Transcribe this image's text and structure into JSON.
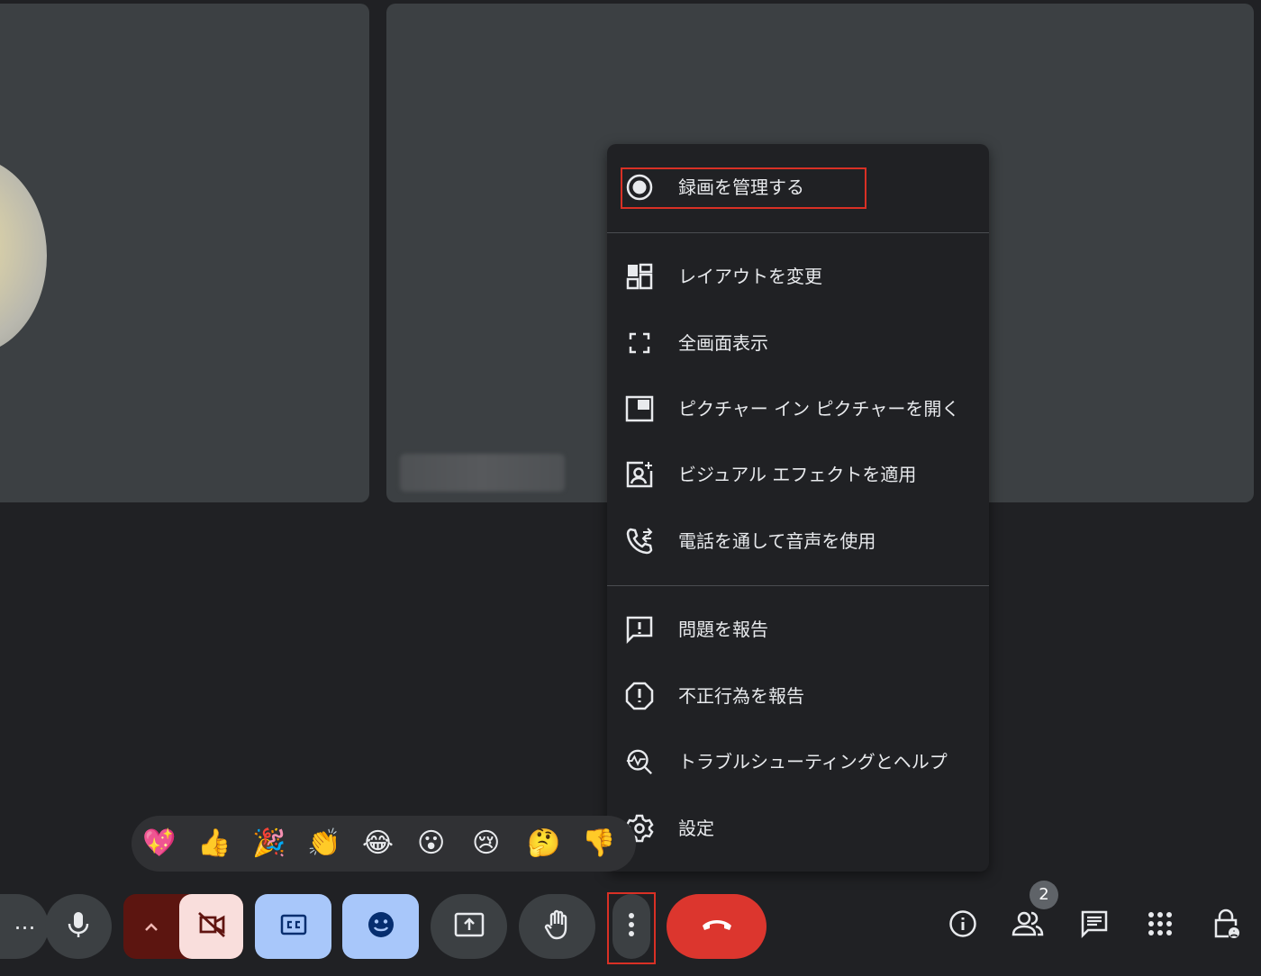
{
  "menu": {
    "items": [
      {
        "label": "録画を管理する",
        "icon": "record-icon"
      },
      {
        "label": "レイアウトを変更",
        "icon": "layout-icon"
      },
      {
        "label": "全画面表示",
        "icon": "fullscreen-icon"
      },
      {
        "label": "ピクチャー イン ピクチャーを開く",
        "icon": "picture-in-picture-icon"
      },
      {
        "label": "ビジュアル エフェクトを適用",
        "icon": "visual-effects-icon"
      },
      {
        "label": "電話を通して音声を使用",
        "icon": "phone-forward-icon"
      },
      {
        "label": "問題を報告",
        "icon": "feedback-icon"
      },
      {
        "label": "不正行為を報告",
        "icon": "report-abuse-icon"
      },
      {
        "label": "トラブルシューティングとヘルプ",
        "icon": "troubleshoot-icon"
      },
      {
        "label": "設定",
        "icon": "settings-icon"
      }
    ]
  },
  "reactions": [
    "💖",
    "👍",
    "🎉",
    "👏",
    "😂",
    "😮",
    "😢",
    "🤔",
    "👎"
  ],
  "controls": {
    "more_left_label": "…",
    "people_count": "2"
  },
  "colors": {
    "background": "#202124",
    "tile": "#3c4043",
    "accent_blue": "#a8c7fa",
    "leave_red": "#dc362e",
    "highlight_red": "#d93025"
  }
}
